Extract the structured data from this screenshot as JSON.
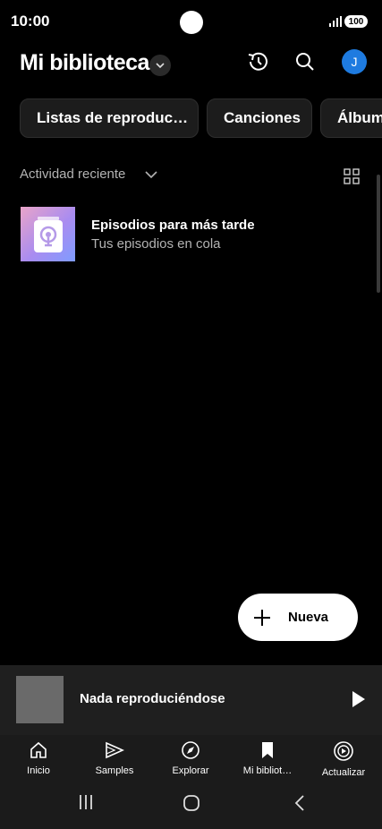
{
  "status": {
    "time": "10:00",
    "battery": "100"
  },
  "header": {
    "title": "Mi biblioteca"
  },
  "chips": [
    "Listas de reproduc…",
    "Canciones",
    "Álbum"
  ],
  "section": {
    "label": "Actividad reciente"
  },
  "items": [
    {
      "title": "Episodios para más tarde",
      "subtitle": "Tus episodios en cola"
    }
  ],
  "fab": {
    "label": "Nueva"
  },
  "mini_player": {
    "title": "Nada reproduciéndose"
  },
  "nav": [
    {
      "label": "Inicio",
      "icon": "home-icon"
    },
    {
      "label": "Samples",
      "icon": "samples-icon"
    },
    {
      "label": "Explorar",
      "icon": "explore-icon"
    },
    {
      "label": "Mi bibliot…",
      "icon": "library-icon"
    },
    {
      "label": "Actualizar",
      "icon": "upgrade-icon"
    }
  ],
  "user": {
    "initial": "J"
  },
  "colors": {
    "background": "#000000",
    "avatar": "#1e7be0",
    "fab": "#ffffff"
  }
}
